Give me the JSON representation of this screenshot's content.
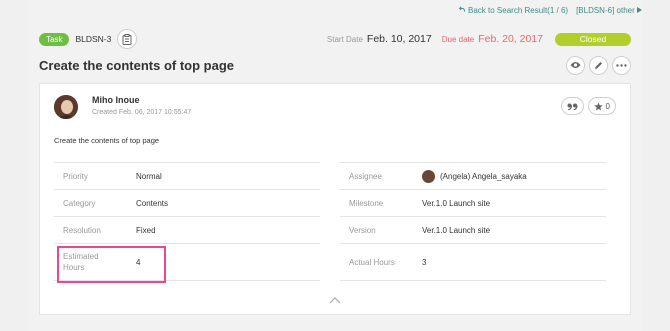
{
  "nav": {
    "back_label": "Back to Search Result(1 / 6)",
    "other_label": "[BLDSN-6] other"
  },
  "issue": {
    "type_label": "Task",
    "key": "BLDSN-3",
    "start_date_label": "Start Date",
    "start_date": "Feb. 10, 2017",
    "due_date_label": "Due date",
    "due_date": "Feb. 20, 2017",
    "status": "Closed",
    "title": "Create the contents of top page"
  },
  "comment": {
    "author": "Miho Inoue",
    "created": "Created  Feb. 06, 2017 10:55:47",
    "star_count": "0",
    "description": "Create the contents of top page"
  },
  "properties_left": [
    {
      "label": "Priority",
      "value": "Normal"
    },
    {
      "label": "Category",
      "value": "Contents"
    },
    {
      "label": "Resolution",
      "value": "Fixed"
    },
    {
      "label": "Estimated Hours",
      "value": "4"
    }
  ],
  "properties_right": [
    {
      "label": "Assignee",
      "value": "(Angela) Angela_sayaka"
    },
    {
      "label": "Milestone",
      "value": "Ver.1.0 Launch site"
    },
    {
      "label": "Version",
      "value": "Ver.1.0 Launch site"
    },
    {
      "label": "Actual Hours",
      "value": "3"
    }
  ],
  "colors": {
    "task_badge": "#6ebe43",
    "status_closed": "#b2ce2b",
    "link": "#3f8c89",
    "due": "#e5676d",
    "highlight": "#e8488f"
  },
  "icons": [
    "back-icon",
    "clipboard-icon",
    "watch-icon",
    "edit-icon",
    "more-icon",
    "quote-icon",
    "star-icon",
    "chevron-up-icon"
  ]
}
